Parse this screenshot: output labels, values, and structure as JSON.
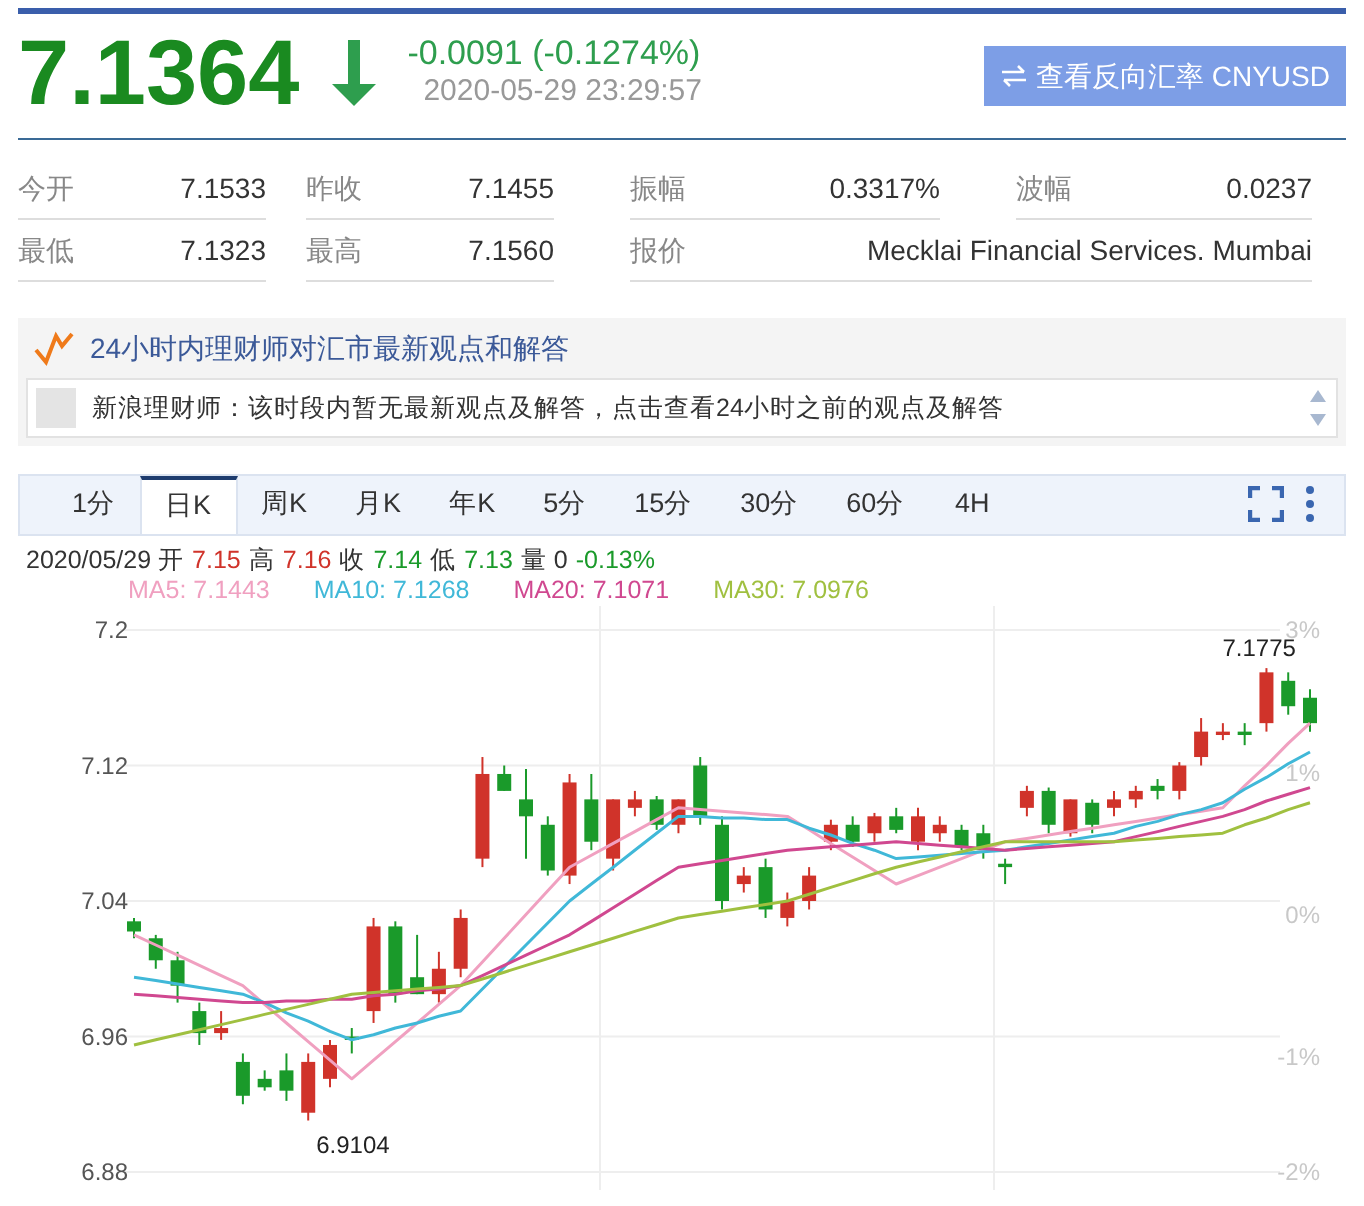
{
  "quote": {
    "price": "7.1364",
    "falling": true,
    "change": "-0.0091 (-0.1274%)",
    "time": "2020-05-29 23:29:57",
    "reverse_button": "查看反向汇率 CNYUSD"
  },
  "stats": [
    {
      "label": "今开",
      "value": "7.1533"
    },
    {
      "label": "昨收",
      "value": "7.1455"
    },
    {
      "label": "振幅",
      "value": "0.3317%"
    },
    {
      "label": "波幅",
      "value": "0.0237"
    },
    {
      "label": "最低",
      "value": "7.1323"
    },
    {
      "label": "最高",
      "value": "7.1560"
    },
    {
      "label": "报价",
      "value": "Mecklai Financial Services. Mumbai"
    }
  ],
  "opinions": {
    "title": "24小时内理财师对汇市最新观点和解答",
    "message": "新浪理财师：该时段内暂无最新观点及解答，点击查看24小时之前的观点及解答"
  },
  "tabs": [
    {
      "label": "1分",
      "selected": false
    },
    {
      "label": "日K",
      "selected": true
    },
    {
      "label": "周K",
      "selected": false
    },
    {
      "label": "月K",
      "selected": false
    },
    {
      "label": "年K",
      "selected": false
    },
    {
      "label": "5分",
      "selected": false
    },
    {
      "label": "15分",
      "selected": false
    },
    {
      "label": "30分",
      "selected": false
    },
    {
      "label": "60分",
      "selected": false
    },
    {
      "label": "4H",
      "selected": false
    }
  ],
  "bar_info": [
    {
      "text": "2020/05/29 开",
      "color": "#333333"
    },
    {
      "text": "7.15",
      "color": "#d0332a"
    },
    {
      "text": "高",
      "color": "#333333"
    },
    {
      "text": "7.16",
      "color": "#d0332a"
    },
    {
      "text": "收",
      "color": "#333333"
    },
    {
      "text": "7.14",
      "color": "#1a9a2a"
    },
    {
      "text": "低",
      "color": "#333333"
    },
    {
      "text": "7.13",
      "color": "#1a9a2a"
    },
    {
      "text": "量 0",
      "color": "#333333"
    },
    {
      "text": "-0.13%",
      "color": "#1a9a2a"
    }
  ],
  "legend": [
    {
      "text": "MA5: 7.1443",
      "color": "#f0a0c0"
    },
    {
      "text": "MA10: 7.1268",
      "color": "#40b8d8"
    },
    {
      "text": "MA20: 7.1071",
      "color": "#d04890"
    },
    {
      "text": "MA30: 7.0976",
      "color": "#a0c040"
    }
  ],
  "chart": {
    "chart_data": {
      "type": "candlestick",
      "grid": true,
      "ylim": [
        6.88,
        7.2
      ],
      "yticks": [
        {
          "value": 7.2,
          "label": "7.2"
        },
        {
          "value": 7.12,
          "label": "7.12"
        },
        {
          "value": 7.04,
          "label": "7.04"
        },
        {
          "value": 6.96,
          "label": "6.96"
        },
        {
          "value": 6.88,
          "label": "6.88"
        }
      ],
      "ohlc": [
        [
          7.028,
          7.03,
          7.018,
          7.022
        ],
        [
          7.018,
          7.02,
          7.0,
          7.005
        ],
        [
          7.005,
          7.01,
          6.98,
          6.99
        ],
        [
          6.975,
          6.98,
          6.955,
          6.962
        ],
        [
          6.962,
          6.975,
          6.958,
          6.965
        ],
        [
          6.945,
          6.95,
          6.92,
          6.925
        ],
        [
          6.935,
          6.94,
          6.928,
          6.93
        ],
        [
          6.94,
          6.95,
          6.922,
          6.928
        ],
        [
          6.915,
          6.95,
          6.9104,
          6.945
        ],
        [
          6.935,
          6.958,
          6.93,
          6.955
        ],
        [
          6.96,
          6.965,
          6.95,
          6.958
        ],
        [
          6.975,
          7.03,
          6.968,
          7.025
        ],
        [
          7.025,
          7.028,
          6.98,
          6.985
        ],
        [
          6.995,
          7.02,
          6.985,
          6.985
        ],
        [
          6.985,
          7.01,
          6.98,
          7.0
        ],
        [
          7.0,
          7.035,
          6.995,
          7.03
        ],
        [
          7.065,
          7.125,
          7.06,
          7.115
        ],
        [
          7.115,
          7.12,
          7.105,
          7.105
        ],
        [
          7.1,
          7.118,
          7.065,
          7.09
        ],
        [
          7.085,
          7.09,
          7.055,
          7.058
        ],
        [
          7.055,
          7.115,
          7.05,
          7.11
        ],
        [
          7.1,
          7.115,
          7.07,
          7.075
        ],
        [
          7.065,
          7.1,
          7.058,
          7.1
        ],
        [
          7.095,
          7.105,
          7.09,
          7.1
        ],
        [
          7.1,
          7.102,
          7.082,
          7.085
        ],
        [
          7.085,
          7.1,
          7.08,
          7.1
        ],
        [
          7.12,
          7.125,
          7.085,
          7.09
        ],
        [
          7.085,
          7.09,
          7.035,
          7.04
        ],
        [
          7.05,
          7.06,
          7.045,
          7.055
        ],
        [
          7.06,
          7.065,
          7.03,
          7.035
        ],
        [
          7.03,
          7.045,
          7.025,
          7.04
        ],
        [
          7.04,
          7.06,
          7.035,
          7.055
        ],
        [
          7.075,
          7.088,
          7.07,
          7.085
        ],
        [
          7.085,
          7.09,
          7.072,
          7.075
        ],
        [
          7.08,
          7.092,
          7.075,
          7.09
        ],
        [
          7.09,
          7.095,
          7.08,
          7.082
        ],
        [
          7.075,
          7.095,
          7.07,
          7.09
        ],
        [
          7.08,
          7.09,
          7.075,
          7.085
        ],
        [
          7.082,
          7.085,
          7.07,
          7.072
        ],
        [
          7.08,
          7.085,
          7.065,
          7.07
        ],
        [
          7.062,
          7.065,
          7.05,
          7.06
        ],
        [
          7.095,
          7.108,
          7.09,
          7.105
        ],
        [
          7.105,
          7.107,
          7.08,
          7.085
        ],
        [
          7.08,
          7.1,
          7.078,
          7.1
        ],
        [
          7.098,
          7.1,
          7.08,
          7.085
        ],
        [
          7.095,
          7.105,
          7.09,
          7.1
        ],
        [
          7.1,
          7.108,
          7.095,
          7.105
        ],
        [
          7.108,
          7.112,
          7.1,
          7.105
        ],
        [
          7.105,
          7.122,
          7.1,
          7.12
        ],
        [
          7.125,
          7.148,
          7.12,
          7.14
        ],
        [
          7.138,
          7.145,
          7.135,
          7.14
        ],
        [
          7.14,
          7.145,
          7.132,
          7.138
        ],
        [
          7.145,
          7.1775,
          7.14,
          7.175
        ],
        [
          7.17,
          7.175,
          7.15,
          7.155
        ],
        [
          7.16,
          7.165,
          7.14,
          7.145
        ]
      ],
      "series": [
        {
          "type": "line",
          "color": "#f0a0c0",
          "values": [
            7.02,
            7.014,
            7.008,
            7.002,
            6.996,
            6.99,
            6.979,
            6.968,
            6.957,
            6.946,
            6.935,
            6.946,
            6.957,
            6.968,
            6.979,
            6.99,
            7.004,
            7.018,
            7.032,
            7.046,
            7.06,
            7.067,
            7.074,
            7.081,
            7.088,
            7.095,
            7.094,
            7.093,
            7.092,
            7.091,
            7.09,
            7.082,
            7.074,
            7.066,
            7.058,
            7.05,
            7.055,
            7.06,
            7.065,
            7.07,
            7.075,
            7.077,
            7.079,
            7.081,
            7.083,
            7.085,
            7.087,
            7.089,
            7.091,
            7.093,
            7.095,
            7.108,
            7.12,
            7.133,
            7.145
          ]
        },
        {
          "type": "line",
          "color": "#40b8d8",
          "values": [
            6.995,
            6.993,
            6.991,
            6.989,
            6.987,
            6.985,
            6.98,
            6.974,
            6.969,
            6.963,
            6.958,
            6.961,
            6.965,
            6.968,
            6.972,
            6.975,
            6.988,
            7.001,
            7.014,
            7.027,
            7.04,
            7.05,
            7.06,
            7.07,
            7.08,
            7.09,
            7.09,
            7.089,
            7.089,
            7.088,
            7.088,
            7.083,
            7.079,
            7.074,
            7.07,
            7.065,
            7.066,
            7.067,
            7.068,
            7.069,
            7.07,
            7.072,
            7.074,
            7.076,
            7.078,
            7.08,
            7.084,
            7.087,
            7.091,
            7.094,
            7.098,
            7.106,
            7.113,
            7.121,
            7.128
          ]
        },
        {
          "type": "line",
          "color": "#d04890",
          "values": [
            6.985,
            6.984,
            6.983,
            6.982,
            6.981,
            6.98,
            6.98,
            6.981,
            6.981,
            6.982,
            6.982,
            6.984,
            6.985,
            6.987,
            6.988,
            6.99,
            6.996,
            7.002,
            7.008,
            7.014,
            7.02,
            7.028,
            7.036,
            7.044,
            7.052,
            7.06,
            7.062,
            7.064,
            7.066,
            7.068,
            7.07,
            7.071,
            7.072,
            7.073,
            7.074,
            7.075,
            7.074,
            7.073,
            7.072,
            7.071,
            7.07,
            7.071,
            7.072,
            7.073,
            7.074,
            7.075,
            7.078,
            7.081,
            7.084,
            7.087,
            7.09,
            7.094,
            7.099,
            7.103,
            7.107
          ]
        },
        {
          "type": "line",
          "color": "#a0c040",
          "values": [
            6.955,
            6.958,
            6.961,
            6.964,
            6.967,
            6.97,
            6.973,
            6.976,
            6.979,
            6.982,
            6.985,
            6.986,
            6.987,
            6.988,
            6.989,
            6.99,
            6.994,
            6.998,
            7.002,
            7.006,
            7.01,
            7.014,
            7.018,
            7.022,
            7.026,
            7.03,
            7.032,
            7.034,
            7.036,
            7.038,
            7.04,
            7.044,
            7.048,
            7.052,
            7.056,
            7.06,
            7.063,
            7.066,
            7.069,
            7.072,
            7.075,
            7.075,
            7.075,
            7.075,
            7.075,
            7.075,
            7.076,
            7.077,
            7.078,
            7.079,
            7.08,
            7.085,
            7.089,
            7.094,
            7.098
          ]
        }
      ],
      "annotations": [
        {
          "text": "7.1775"
        },
        {
          "text": "6.9104"
        }
      ]
    },
    "right_ticks": [
      "3%",
      "1%",
      "0%",
      "-1%",
      "-2%"
    ]
  }
}
